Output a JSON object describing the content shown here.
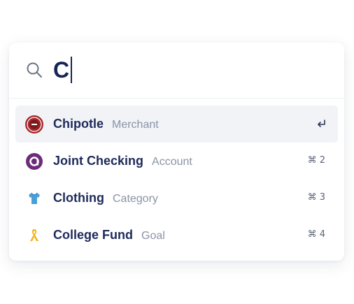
{
  "search": {
    "query": "C"
  },
  "results": [
    {
      "title": "Chipotle",
      "type": "Merchant",
      "shortcut": "",
      "icon": "chipotle-logo-icon",
      "selected": true
    },
    {
      "title": "Joint Checking",
      "type": "Account",
      "shortcut": "⌘ 2",
      "icon": "bank-logo-icon",
      "selected": false
    },
    {
      "title": "Clothing",
      "type": "Category",
      "shortcut": "⌘ 3",
      "icon": "shirt-icon",
      "selected": false
    },
    {
      "title": "College Fund",
      "type": "Goal",
      "shortcut": "⌘ 4",
      "icon": "ribbon-icon",
      "selected": false
    }
  ],
  "colors": {
    "title": "#1e2a5a",
    "muted": "#8a93a6",
    "selected_bg": "#f1f3f7"
  }
}
